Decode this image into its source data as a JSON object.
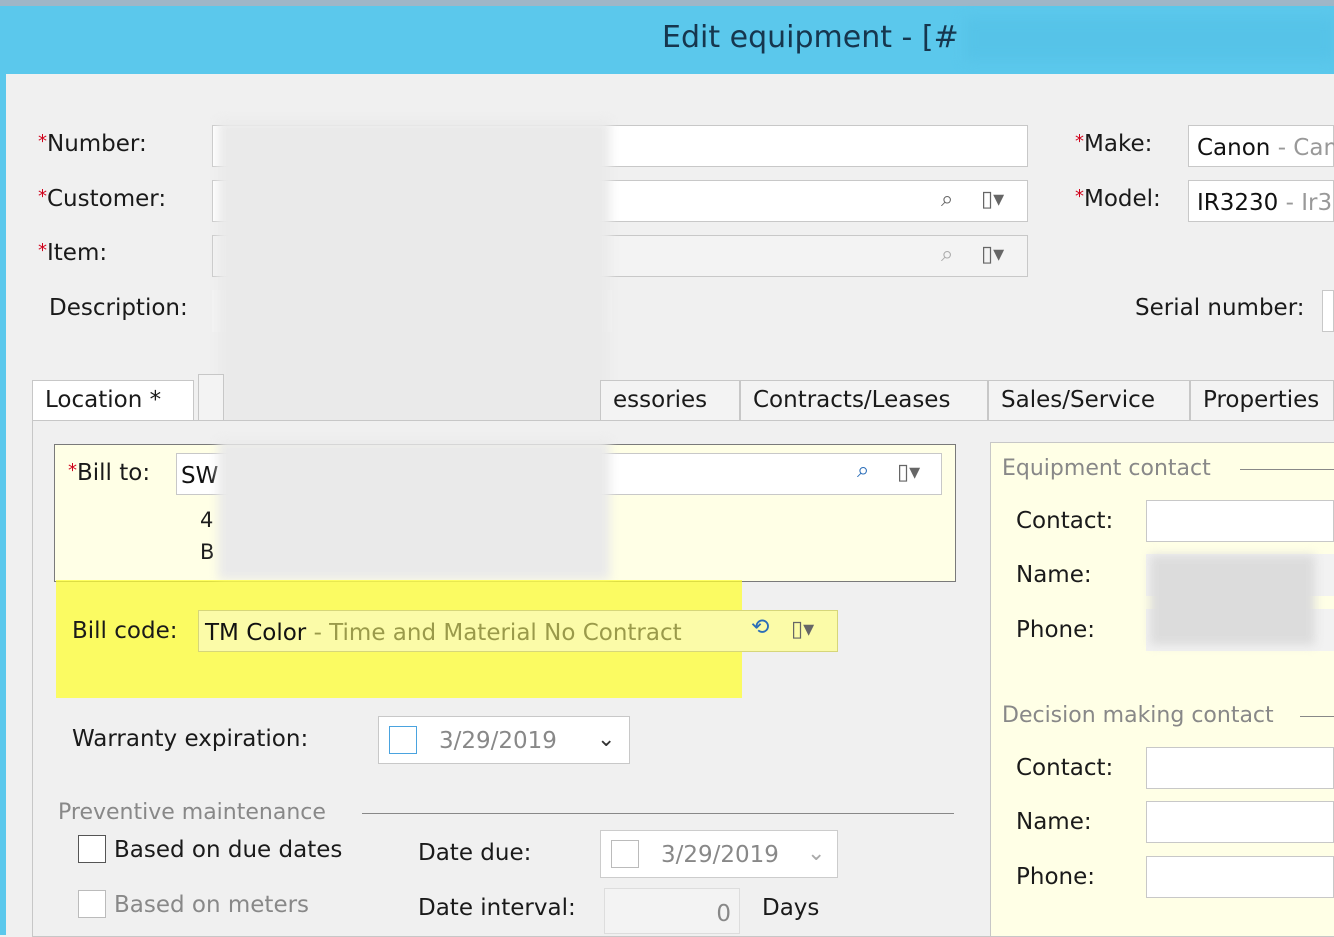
{
  "window": {
    "title_visible": "Edit equipment - [#"
  },
  "fields": {
    "number_label": "Number:",
    "customer_label": "Customer:",
    "item_label": "Item:",
    "description_label": "Description:",
    "required_marker": "*",
    "make_label": "Make:",
    "make_value": "Canon",
    "make_detail": " - Can",
    "model_label": "Model:",
    "model_value": "IR3230",
    "model_detail": " - Ir3",
    "serial_label": "Serial number:"
  },
  "tabs": [
    {
      "label": "Location *"
    },
    {
      "label": "essories"
    },
    {
      "label": "Contracts/Leases"
    },
    {
      "label": "Sales/Service"
    },
    {
      "label": "Properties"
    }
  ],
  "billing": {
    "bill_to_label": "Bill to:",
    "bill_to_value": "SW",
    "addr_line1": "4",
    "addr_line2": "B",
    "bill_code_label": "Bill code:",
    "bill_code_value": "TM Color",
    "bill_code_detail": " - Time and Material No Contract",
    "warranty_label": "Warranty expiration:",
    "warranty_date": "3/29/2019"
  },
  "preventive": {
    "group_label": "Preventive maintenance",
    "based_due_dates": "Based on due dates",
    "based_meters": "Based on meters",
    "date_due_label": "Date due:",
    "date_due_value": "3/29/2019",
    "interval_label": "Date interval:",
    "interval_value": "0",
    "interval_unit": "Days"
  },
  "contacts": {
    "equipment_group": "Equipment contact",
    "decision_group": "Decision making contact",
    "contact_label": "Contact:",
    "name_label": "Name:",
    "phone_label": "Phone:"
  },
  "icons": [
    "search-icon",
    "document-dropdown-icon",
    "chevron-down-icon",
    "refresh-search-icon"
  ],
  "colors": {
    "titlebar": "#5bc8ec",
    "highlight": "#ffff33",
    "required": "#d0021b",
    "yellow_panel": "#ffffe6"
  }
}
